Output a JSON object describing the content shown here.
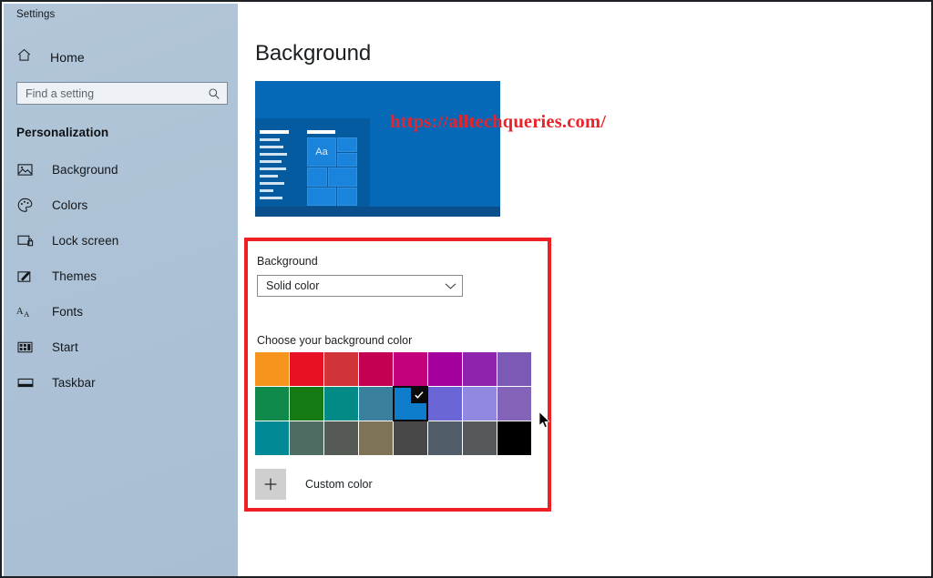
{
  "window": {
    "app_title": "Settings"
  },
  "sidebar": {
    "home_label": "Home",
    "home_icon": "home-icon",
    "search": {
      "placeholder": "Find a setting",
      "value": "",
      "icon": "search-icon"
    },
    "section_header": "Personalization",
    "items": [
      {
        "label": "Background",
        "icon": "picture-icon"
      },
      {
        "label": "Colors",
        "icon": "palette-icon"
      },
      {
        "label": "Lock screen",
        "icon": "lock-screen-icon"
      },
      {
        "label": "Themes",
        "icon": "themes-brush-icon"
      },
      {
        "label": "Fonts",
        "icon": "fonts-aa-icon"
      },
      {
        "label": "Start",
        "icon": "start-tiles-icon"
      },
      {
        "label": "Taskbar",
        "icon": "taskbar-icon"
      }
    ]
  },
  "main": {
    "page_title": "Background",
    "preview": {
      "name": "desktop-preview",
      "desktop_color": "#0669b8",
      "tile_text": "Aa"
    },
    "background_field": {
      "label": "Background",
      "selected_option": "Solid color",
      "chevron_icon": "chevron-down-icon"
    },
    "choose_color_label": "Choose your background color",
    "color_grid": {
      "columns": 8,
      "selected_index": 12,
      "check_icon": "check-icon",
      "colors": [
        "#f7941d",
        "#e81123",
        "#d13438",
        "#c30052",
        "#c4017c",
        "#a4009e",
        "#8e23ad",
        "#7b5ab5",
        "#0f8a4a",
        "#167a12",
        "#028a86",
        "#3a7f9c",
        "#0c7ccb",
        "#6a66d6",
        "#9188e0",
        "#8364b8",
        "#018a96",
        "#4e6c62",
        "#565a54",
        "#7e7357",
        "#484848",
        "#515c69",
        "#55595c",
        "#000000"
      ]
    },
    "custom_color": {
      "label": "Custom color",
      "icon": "plus-icon"
    },
    "highlight_box": {
      "name": "red-highlight-box",
      "color": "#ee2025"
    }
  },
  "overlay": {
    "watermark_text": "https://alltechqueries.com/",
    "watermark_color": "#e8242a",
    "cursor_icon": "mouse-pointer-icon"
  }
}
